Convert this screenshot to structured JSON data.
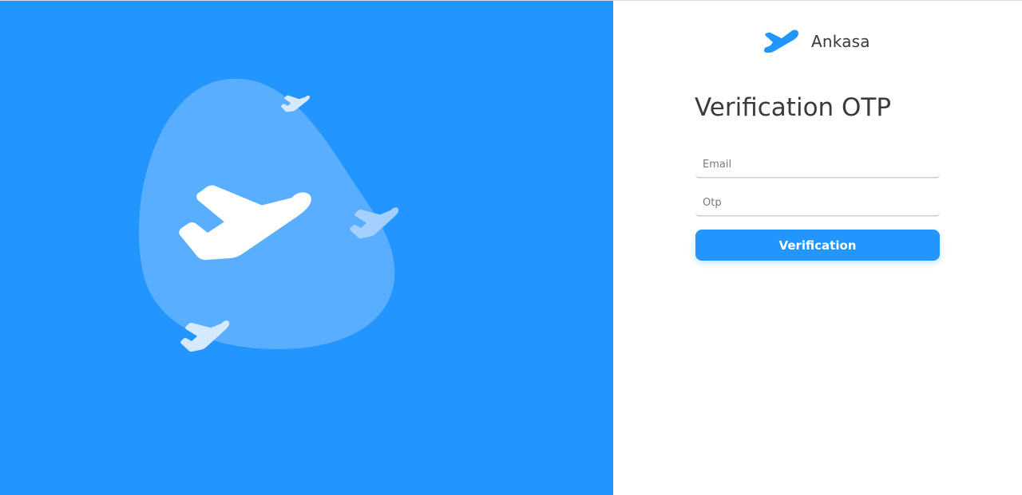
{
  "brand": {
    "name": "Ankasa",
    "logo_icon": "plane-icon",
    "accent_color": "#2395ff"
  },
  "form": {
    "title": "Verification OTP",
    "email": {
      "placeholder": "Email",
      "value": ""
    },
    "otp": {
      "placeholder": "Otp",
      "value": ""
    },
    "submit_label": "Verification"
  },
  "illustration": {
    "background_color": "#2395ff",
    "blob_color": "#5aaeff",
    "icons": [
      "plane-icon",
      "plane-icon",
      "plane-icon",
      "plane-icon"
    ]
  }
}
